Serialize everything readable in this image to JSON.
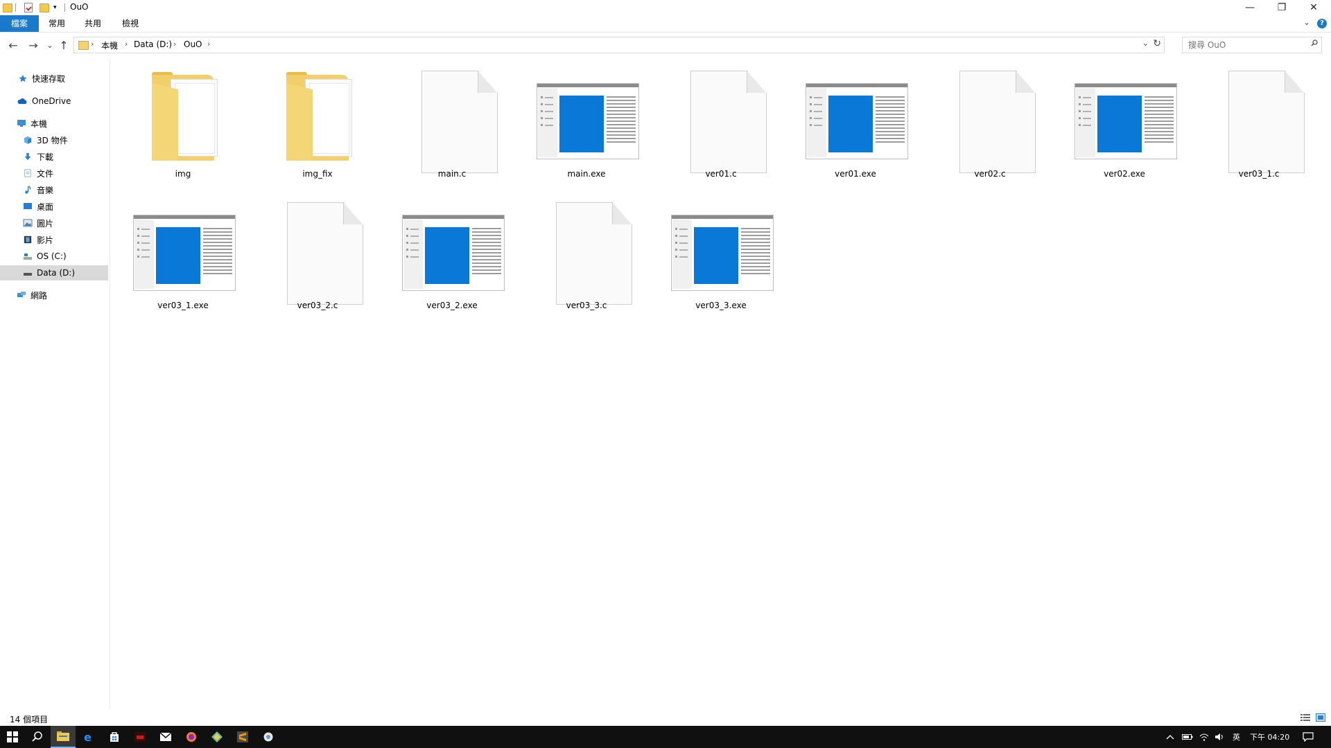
{
  "window": {
    "title": "OuO",
    "minimize_label": "—",
    "restore_label": "❐",
    "close_label": "✕"
  },
  "ribbon": {
    "tabs": [
      "檔案",
      "常用",
      "共用",
      "檢視"
    ],
    "collapse_label": "⌄",
    "help_label": "?"
  },
  "nav": {
    "back": "←",
    "forward": "→",
    "recent": "⌄",
    "up": "↑"
  },
  "address": {
    "crumbs": [
      "本機",
      "Data (D:)",
      "OuO"
    ],
    "separator": "›",
    "dropdown": "⌄",
    "refresh": "↻"
  },
  "search": {
    "placeholder": "搜尋 OuO"
  },
  "sidebar": {
    "items": [
      {
        "label": "快速存取",
        "icon": "star-icon"
      },
      {
        "label": "OneDrive",
        "icon": "cloud-icon"
      },
      {
        "label": "本機",
        "icon": "computer-icon"
      },
      {
        "label": "3D 物件",
        "icon": "cube-icon"
      },
      {
        "label": "下載",
        "icon": "download-icon"
      },
      {
        "label": "文件",
        "icon": "document-icon"
      },
      {
        "label": "音樂",
        "icon": "music-icon"
      },
      {
        "label": "桌面",
        "icon": "desktop-icon"
      },
      {
        "label": "圖片",
        "icon": "pictures-icon"
      },
      {
        "label": "影片",
        "icon": "video-icon"
      },
      {
        "label": "OS (C:)",
        "icon": "drive-c-icon"
      },
      {
        "label": "Data (D:)",
        "icon": "drive-d-icon"
      },
      {
        "label": "網路",
        "icon": "network-icon"
      }
    ],
    "selected": "Data (D:)"
  },
  "files": [
    {
      "name": "img",
      "type": "folder"
    },
    {
      "name": "img_fix",
      "type": "folder"
    },
    {
      "name": "main.c",
      "type": "file"
    },
    {
      "name": "main.exe",
      "type": "exe"
    },
    {
      "name": "ver01.c",
      "type": "file"
    },
    {
      "name": "ver01.exe",
      "type": "exe"
    },
    {
      "name": "ver02.c",
      "type": "file"
    },
    {
      "name": "ver02.exe",
      "type": "exe"
    },
    {
      "name": "ver03_1.c",
      "type": "file"
    },
    {
      "name": "ver03_1.exe",
      "type": "exe"
    },
    {
      "name": "ver03_2.c",
      "type": "file"
    },
    {
      "name": "ver03_2.exe",
      "type": "exe"
    },
    {
      "name": "ver03_3.c",
      "type": "file"
    },
    {
      "name": "ver03_3.exe",
      "type": "exe"
    }
  ],
  "status": {
    "item_count": "14 個項目"
  },
  "taskbar": {
    "apps": [
      "start-icon",
      "search-icon",
      "file-explorer-icon",
      "edge-icon",
      "store-icon",
      "app-red-icon",
      "mail-icon",
      "firefox-icon",
      "git-icon",
      "sublime-icon",
      "app-misc-icon"
    ],
    "tray": {
      "ime": "英",
      "clock": "下午 04:20"
    }
  },
  "colors": {
    "accent": "#1979ca",
    "folder": "#f2cf6a",
    "exe_blue": "#0a78d7",
    "taskbar": "#101010"
  }
}
